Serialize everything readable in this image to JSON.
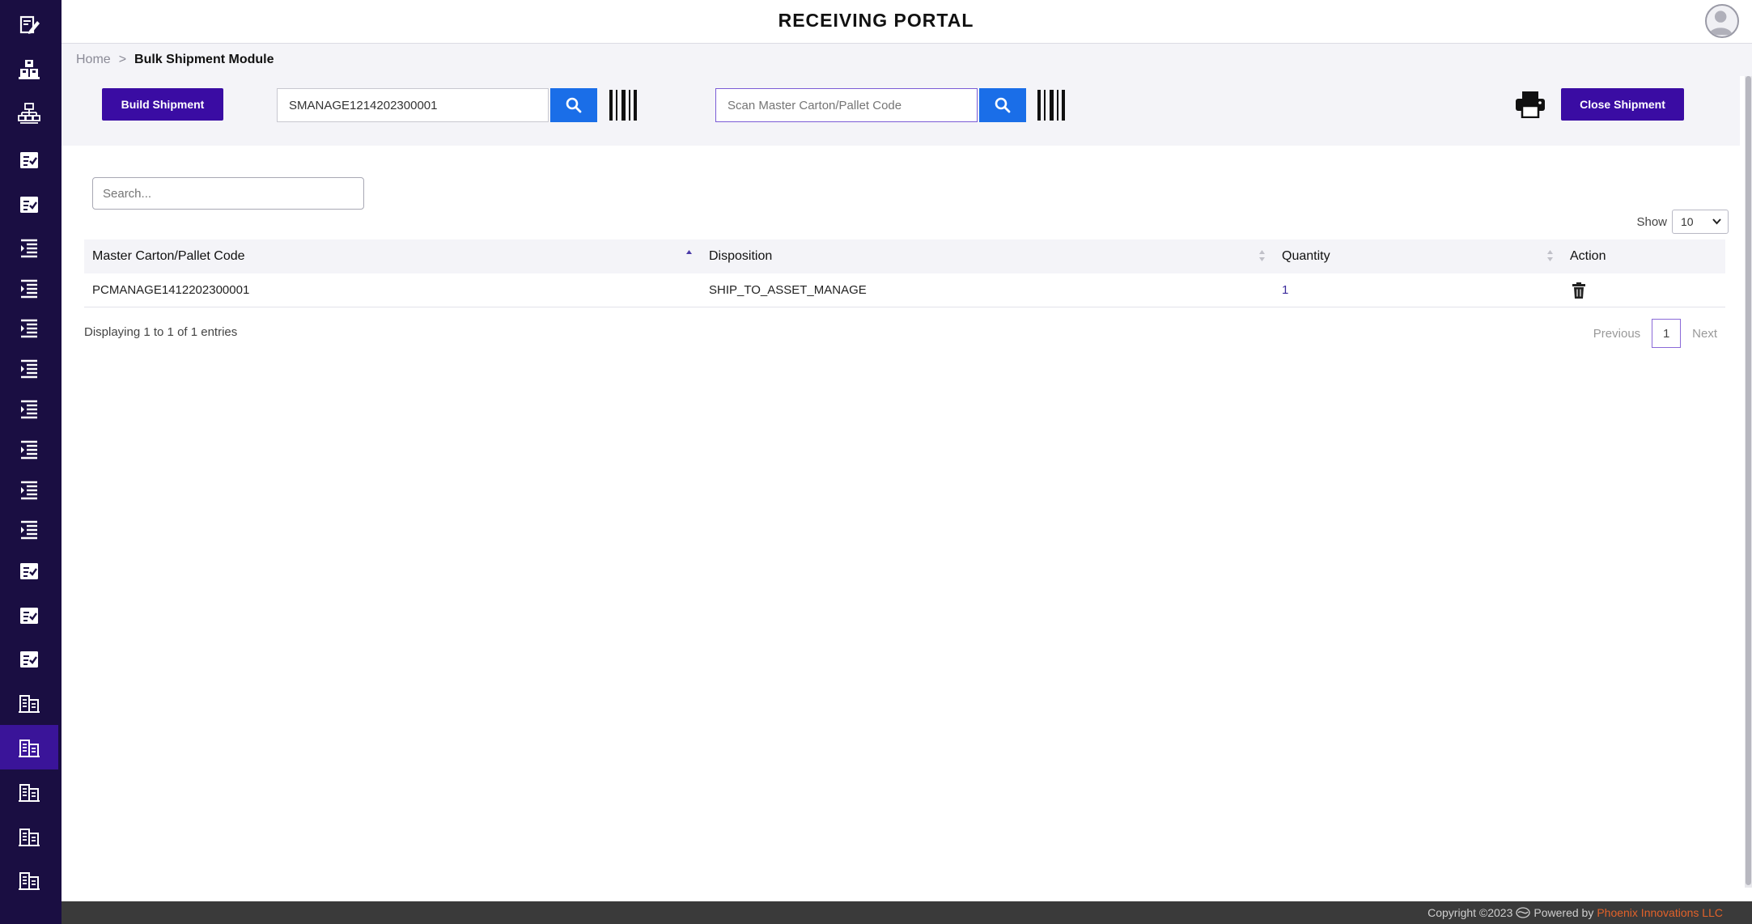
{
  "app": {
    "title": "RECEIVING PORTAL"
  },
  "colors": {
    "sidebar": "#1a0e42",
    "sidebar_active": "#3a1499",
    "primary": "#3a0ca3",
    "search_button": "#1a6ee8",
    "footer_brand": "#e2622a"
  },
  "sidebar": {
    "items": [
      {
        "icon": "edit-note-icon"
      },
      {
        "icon": "boxes-icon"
      },
      {
        "icon": "org-chart-icon"
      },
      {
        "icon": "checklist-icon"
      },
      {
        "icon": "checklist-icon"
      },
      {
        "icon": "indent-list-icon"
      },
      {
        "icon": "indent-list-icon"
      },
      {
        "icon": "indent-list-icon"
      },
      {
        "icon": "indent-list-icon"
      },
      {
        "icon": "indent-list-icon"
      },
      {
        "icon": "indent-list-icon"
      },
      {
        "icon": "indent-list-icon"
      },
      {
        "icon": "indent-list-icon"
      },
      {
        "icon": "checklist-icon"
      },
      {
        "icon": "checklist-icon"
      },
      {
        "icon": "checklist-icon"
      },
      {
        "icon": "building-icon"
      },
      {
        "icon": "building-icon",
        "active": true
      },
      {
        "icon": "building-icon"
      },
      {
        "icon": "building-icon"
      },
      {
        "icon": "building-icon"
      }
    ]
  },
  "breadcrumb": {
    "home": "Home",
    "separator": ">",
    "current": "Bulk Shipment Module"
  },
  "toolbar": {
    "build_label": "Build Shipment",
    "shipment_value": "SMANAGE1214202300001",
    "carton_placeholder": "Scan Master Carton/Pallet Code",
    "close_label": "Close Shipment"
  },
  "table": {
    "search_placeholder": "Search...",
    "show_label": "Show",
    "page_size": "10",
    "headers": [
      "Master Carton/Pallet Code",
      "Disposition",
      "Quantity",
      "Action"
    ],
    "rows": [
      {
        "code": "PCMANAGE1412202300001",
        "disposition": "SHIP_TO_ASSET_MANAGE",
        "quantity": "1"
      }
    ],
    "info": "Displaying 1 to 1 of 1 entries",
    "pagination": {
      "previous": "Previous",
      "page": "1",
      "next": "Next"
    }
  },
  "footer": {
    "copyright": "Copyright ©2023",
    "powered_by": "Powered by",
    "brand": "Phoenix Innovations LLC"
  }
}
